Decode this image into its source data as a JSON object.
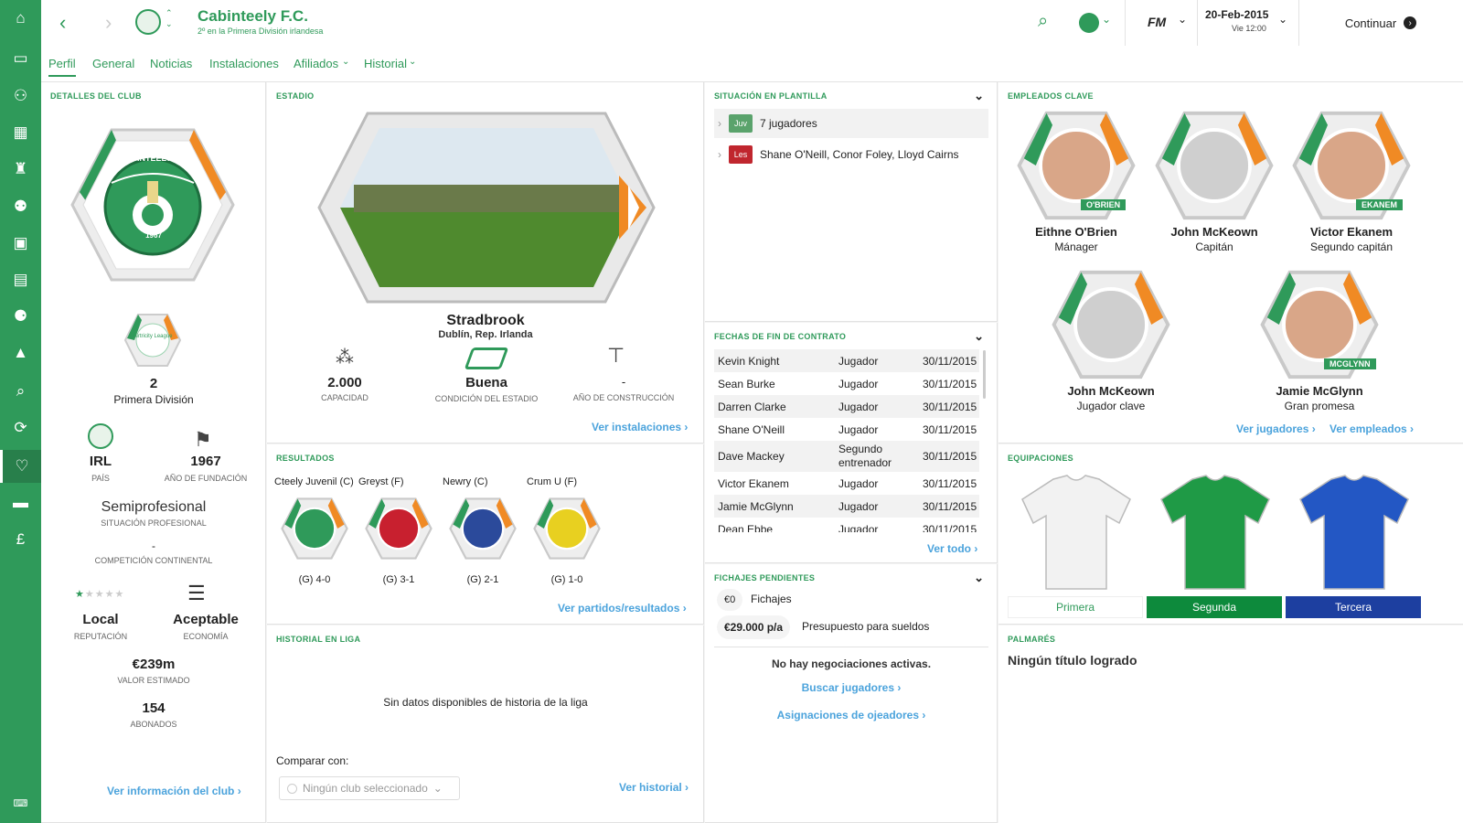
{
  "sidebar": {
    "icons": [
      "home-icon",
      "inbox-icon",
      "squad-icon",
      "calendar-icon",
      "trophy-icon",
      "youth-icon",
      "tactics-icon",
      "training-icon",
      "staff-icon",
      "medical-icon",
      "search-icon",
      "transfers-icon",
      "club-icon",
      "finance-icon",
      "money-icon",
      "keyboard-icon"
    ]
  },
  "header": {
    "club_name": "Cabinteely F.C.",
    "subtitle": "2º en la Primera División irlandesa",
    "date": "20-Feb-2015",
    "time": "Vie 12:00",
    "continue_label": "Continuar",
    "fm_label": "FM"
  },
  "tabs": [
    {
      "label": "Perfil"
    },
    {
      "label": "General"
    },
    {
      "label": "Noticias"
    },
    {
      "label": "Instalaciones"
    },
    {
      "label": "Afiliados"
    },
    {
      "label": "Historial"
    }
  ],
  "club_details": {
    "title": "DETALLES DEL CLUB",
    "crest_text": "CABINTEELY F.C.",
    "crest_year": "1967",
    "league_logo": "Airtricity League",
    "position": "2",
    "league": "Primera División",
    "country": "IRL",
    "country_label": "PAÍS",
    "founded": "1967",
    "founded_label": "AÑO DE FUNDACIÓN",
    "status": "Semiprofesional",
    "status_label": "SITUACIÓN PROFESIONAL",
    "continental": "-",
    "continental_label": "COMPETICIÓN CONTINENTAL",
    "reputation": "Local",
    "reputation_label": "REPUTACIÓN",
    "reputation_stars": 1,
    "economy": "Aceptable",
    "economy_label": "ECONOMÍA",
    "value": "€239m",
    "value_label": "VALOR ESTIMADO",
    "members": "154",
    "members_label": "ABONADOS",
    "link": "Ver información del club"
  },
  "stadium": {
    "title": "ESTADIO",
    "name": "Stradbrook",
    "location": "Dublín, Rep. Irlanda",
    "capacity": "2.000",
    "capacity_label": "CAPACIDAD",
    "condition": "Buena",
    "condition_label": "CONDICIÓN DEL ESTADIO",
    "built": "-",
    "built_label": "AÑO DE CONSTRUCCIÓN",
    "link": "Ver instalaciones"
  },
  "results": {
    "title": "RESULTADOS",
    "matches": [
      {
        "team": "Cteely Juvenil (C)",
        "score": "(G) 4-0",
        "color": "#2f9a5a"
      },
      {
        "team": "Greyst (F)",
        "score": "(G) 3-1",
        "color": "#c8202f"
      },
      {
        "team": "Newry (C)",
        "score": "(G) 2-1",
        "color": "#2b4a9b"
      },
      {
        "team": "Crum U (F)",
        "score": "(G) 1-0",
        "color": "#e8d020"
      }
    ],
    "link": "Ver partidos/resultados"
  },
  "league_history": {
    "title": "HISTORIAL EN LIGA",
    "empty": "Sin datos disponibles de historia de la liga",
    "compare_label": "Comparar con:",
    "compare_value": "Ningún club seleccionado",
    "link": "Ver historial"
  },
  "squad": {
    "title": "SITUACIÓN EN PLANTILLA",
    "rows": [
      {
        "badge": "Juv",
        "text": "7 jugadores",
        "color": "#5aa36c"
      },
      {
        "badge": "Les",
        "text": "Shane O'Neill, Conor Foley, Lloyd Cairns",
        "color": "#c0262e"
      }
    ]
  },
  "contracts": {
    "title": "FECHAS DE FIN DE CONTRATO",
    "rows": [
      {
        "name": "Kevin Knight",
        "role": "Jugador",
        "date": "30/11/2015"
      },
      {
        "name": "Sean Burke",
        "role": "Jugador",
        "date": "30/11/2015"
      },
      {
        "name": "Darren Clarke",
        "role": "Jugador",
        "date": "30/11/2015"
      },
      {
        "name": "Shane O'Neill",
        "role": "Jugador",
        "date": "30/11/2015"
      },
      {
        "name": "Dave Mackey",
        "role": "Segundo entrenador",
        "date": "30/11/2015"
      },
      {
        "name": "Victor Ekanem",
        "role": "Jugador",
        "date": "30/11/2015"
      },
      {
        "name": "Jamie McGlynn",
        "role": "Jugador",
        "date": "30/11/2015"
      },
      {
        "name": "Dean Ebbe",
        "role": "Jugador",
        "date": "30/11/2015"
      }
    ],
    "link": "Ver todo"
  },
  "pending": {
    "title": "FICHAJES PENDIENTES",
    "transfer_amount": "€0",
    "transfer_label": "Fichajes",
    "wage_amount": "€29.000 p/a",
    "wage_label": "Presupuesto para sueldos",
    "no_negotiations": "No hay negociaciones activas.",
    "search_link": "Buscar jugadores",
    "scout_link": "Asignaciones de ojeadores"
  },
  "key_staff": {
    "title": "EMPLEADOS CLAVE",
    "people": [
      {
        "name": "Eithne O'Brien",
        "role": "Mánager",
        "tag": "O'BRIEN",
        "photo": true
      },
      {
        "name": "John McKeown",
        "role": "Capitán",
        "tag": "",
        "photo": false
      },
      {
        "name": "Victor Ekanem",
        "role": "Segundo capitán",
        "tag": "EKANEM",
        "photo": true
      },
      {
        "name": "John McKeown",
        "role": "Jugador clave",
        "tag": "",
        "photo": false
      },
      {
        "name": "Jamie McGlynn",
        "role": "Gran promesa",
        "tag": "MCGLYNN",
        "photo": true
      }
    ],
    "players_link": "Ver jugadores",
    "staff_link": "Ver empleados"
  },
  "kits": {
    "title": "EQUIPACIONES",
    "items": [
      {
        "label": "Primera",
        "color": "#f2f2f2",
        "bar": "#ffffff",
        "text": "#2f9a5a"
      },
      {
        "label": "Segunda",
        "color": "#1f9a46",
        "bar": "#0d8a3c",
        "text": "#ffffff"
      },
      {
        "label": "Tercera",
        "color": "#2357c4",
        "bar": "#1d3fa0",
        "text": "#ffffff"
      }
    ]
  },
  "honours": {
    "title": "PALMARÉS",
    "text": "Ningún título logrado"
  }
}
